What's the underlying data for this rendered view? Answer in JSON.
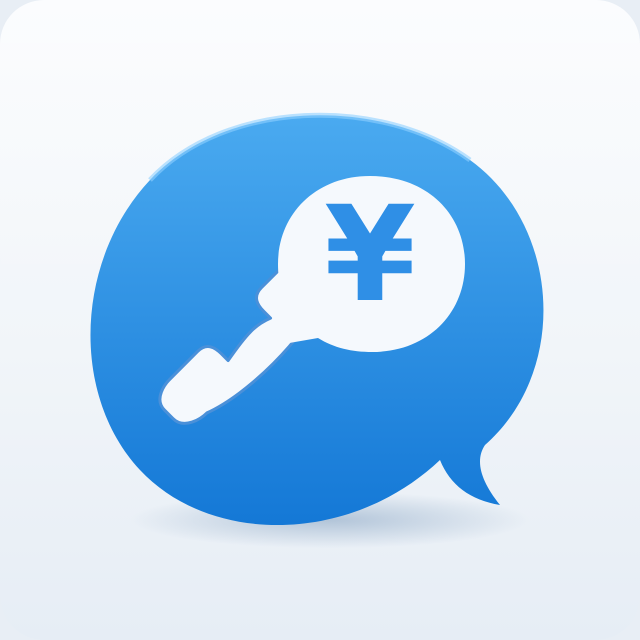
{
  "app_icon": {
    "currency_symbol": "¥",
    "glyphs": {
      "outer_bubble": "speech-bubble-icon",
      "handset": "phone-handset-icon",
      "inner_bubble": "speech-bubble-icon",
      "currency": "yen-icon"
    },
    "colors": {
      "background_top": "#f9fbfd",
      "background_bottom": "#e6edf5",
      "bubble_light": "#4aaaf0",
      "bubble_dark": "#1478d6",
      "glyph": "#f5f9fd"
    }
  }
}
